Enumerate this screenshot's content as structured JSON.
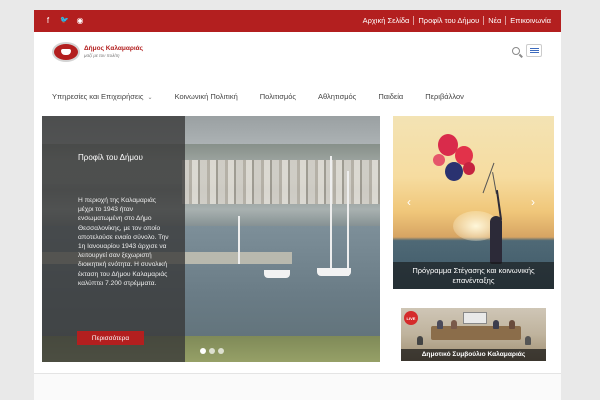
{
  "topbar": {
    "social": [
      {
        "icon": "facebook-icon",
        "glyph": "f"
      },
      {
        "icon": "twitter-icon",
        "glyph": "🐦"
      },
      {
        "icon": "rss-icon",
        "glyph": "◉"
      }
    ],
    "links": [
      "Αρχική Σελίδα",
      "Προφίλ του Δήμου",
      "Νέα",
      "Επικοινωνία"
    ]
  },
  "header": {
    "logo_title": "Δήμος Καλαμαριάς",
    "logo_subtitle": "μαζί με τον πολίτη",
    "search_icon": "search-icon",
    "language_icon": "greek-flag-icon"
  },
  "nav": {
    "items": [
      {
        "label": "Υπηρεσίες και Επιχειρήσεις",
        "has_dropdown": true
      },
      {
        "label": "Κοινωνική Πολιτική",
        "has_dropdown": false
      },
      {
        "label": "Πολιτισμός",
        "has_dropdown": false
      },
      {
        "label": "Αθλητισμός",
        "has_dropdown": false
      },
      {
        "label": "Παιδεία",
        "has_dropdown": false
      },
      {
        "label": "Περιβάλλον",
        "has_dropdown": false
      }
    ],
    "dropdown_glyph": "⌄"
  },
  "slider": {
    "title": "Προφίλ του Δήμου",
    "text": "Η περιοχή της Καλαμαριάς μέχρι το 1943 ήταν ενσωματωμένη στο Δήμο Θεσσαλονίκης, με τον οποίο αποτελούσε ενιαίο σύνολο. Την 1η Ιανουαρίου 1943 άρχισε να λειτουργεί σαν ξεχωριστή διοικητική ενότητα. Η συνολική έκταση του Δήμου Καλαμαριάς καλύπτει 7.200 στρέμματα.",
    "button_label": "Περισσότερα",
    "slides_total": 3,
    "active_slide": 1
  },
  "side_card_1": {
    "caption": "Πρόγραμμα Στέγασης και κοινωνικής επανένταξης",
    "prev_glyph": "‹",
    "next_glyph": "›"
  },
  "side_card_2": {
    "caption": "Δημοτικό Συμβούλιο Καλαμαριάς",
    "badge": "LIVE"
  },
  "colors": {
    "brand_red": "#b31f1f",
    "background": "#e9e9e9"
  }
}
